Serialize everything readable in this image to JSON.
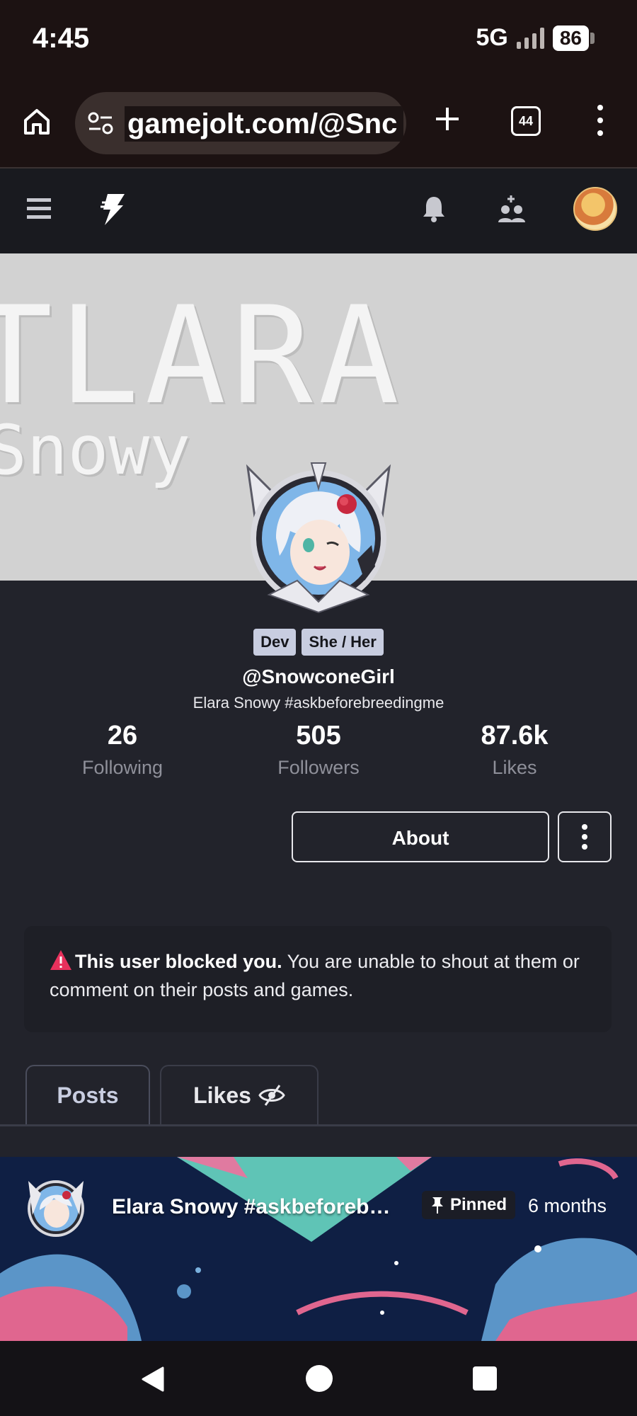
{
  "status_bar": {
    "time": "4:45",
    "network": "5G",
    "battery": "86"
  },
  "browser": {
    "url": "gamejolt.com/@Snc",
    "tab_count": "44"
  },
  "profile": {
    "tags": [
      "Dev",
      "She / Her"
    ],
    "username": "@SnowconeGirl",
    "display_name": "Elara Snowy #askbeforebreedingme",
    "banner_text_1": "TLARA",
    "banner_text_2": "Snowy",
    "stats": [
      {
        "value": "26",
        "label": "Following"
      },
      {
        "value": "505",
        "label": "Followers"
      },
      {
        "value": "87.6k",
        "label": "Likes"
      }
    ],
    "about_label": "About"
  },
  "blocked_notice": {
    "bold": "This user blocked you.",
    "text": " You are unable to shout at them or comment on their posts and games."
  },
  "tabs": [
    {
      "label": "Posts",
      "active": true
    },
    {
      "label": "Likes",
      "icon": "hidden-eye-icon"
    }
  ],
  "post": {
    "author": "Elara Snowy #askbeforebreedingme",
    "pinned_label": "Pinned",
    "time": "6 months"
  },
  "colors": {
    "background": "#22232b",
    "header": "#191a1f",
    "tag_bg": "#c8cde0",
    "warning": "#e8315c"
  }
}
